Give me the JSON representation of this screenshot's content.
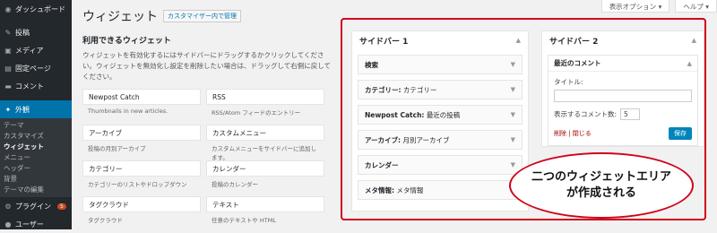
{
  "sidebar": {
    "dashboard": "ダッシュボード",
    "posts": "投稿",
    "media": "メディア",
    "pages": "固定ページ",
    "comments": "コメント",
    "appearance": "外観",
    "sub": [
      "テーマ",
      "カスタマイズ",
      "ウィジェット",
      "メニュー",
      "ヘッダー",
      "背景",
      "テーマの編集"
    ],
    "plugins": "プラグイン",
    "plugins_badge": "5",
    "users": "ユーザー"
  },
  "topbar": {
    "screen_options": "表示オプション ▾",
    "help": "ヘルプ ▾"
  },
  "page": {
    "title": "ウィジェット",
    "customizer_button": "カスタマイザー内で管理"
  },
  "available": {
    "heading": "利用できるウィジェット",
    "desc": "ウィジェットを有効化するにはサイドバーにドラッグするかクリックしてください。ウィジェットを無効化し設定を削除したい場合は、ドラッグして右側に戻してください。",
    "widgets": [
      {
        "title": "Newpost Catch",
        "desc": "Thumbnails in new articles."
      },
      {
        "title": "RSS",
        "desc": "RSS/Atom フィードのエントリー"
      },
      {
        "title": "アーカイブ",
        "desc": "投稿の月別アーカイブ"
      },
      {
        "title": "カスタムメニュー",
        "desc": "カスタムメニューをサイドバーに追加します。"
      },
      {
        "title": "カテゴリー",
        "desc": "カテゴリーのリストやドロップダウン"
      },
      {
        "title": "カレンダー",
        "desc": "投稿のカレンダー"
      },
      {
        "title": "タグクラウド",
        "desc": "タグクラウド"
      },
      {
        "title": "テキスト",
        "desc": "任意のテキストや HTML"
      }
    ]
  },
  "sidebar1": {
    "title": "サイドバー 1",
    "widgets": [
      {
        "title": "検索",
        "sub": ""
      },
      {
        "title": "カテゴリー:",
        "sub": "カテゴリー"
      },
      {
        "title": "Newpost Catch:",
        "sub": "最近の投稿"
      },
      {
        "title": "アーカイブ:",
        "sub": "月別アーカイブ"
      },
      {
        "title": "カレンダー",
        "sub": ""
      },
      {
        "title": "メタ情報:",
        "sub": "メタ情報"
      }
    ]
  },
  "sidebar2": {
    "title": "サイドバー 2",
    "widget_title": "最近のコメント",
    "title_label": "タイトル:",
    "title_value": "",
    "count_label": "表示するコメント数:",
    "count_value": "5",
    "delete_link": "削除 | 閉じる",
    "save_label": "保存"
  },
  "callout": {
    "line1": "二つのウィジェットエリア",
    "line2": "が作成される"
  },
  "colors": {
    "accent": "#0073aa",
    "highlight": "#d0021b"
  }
}
